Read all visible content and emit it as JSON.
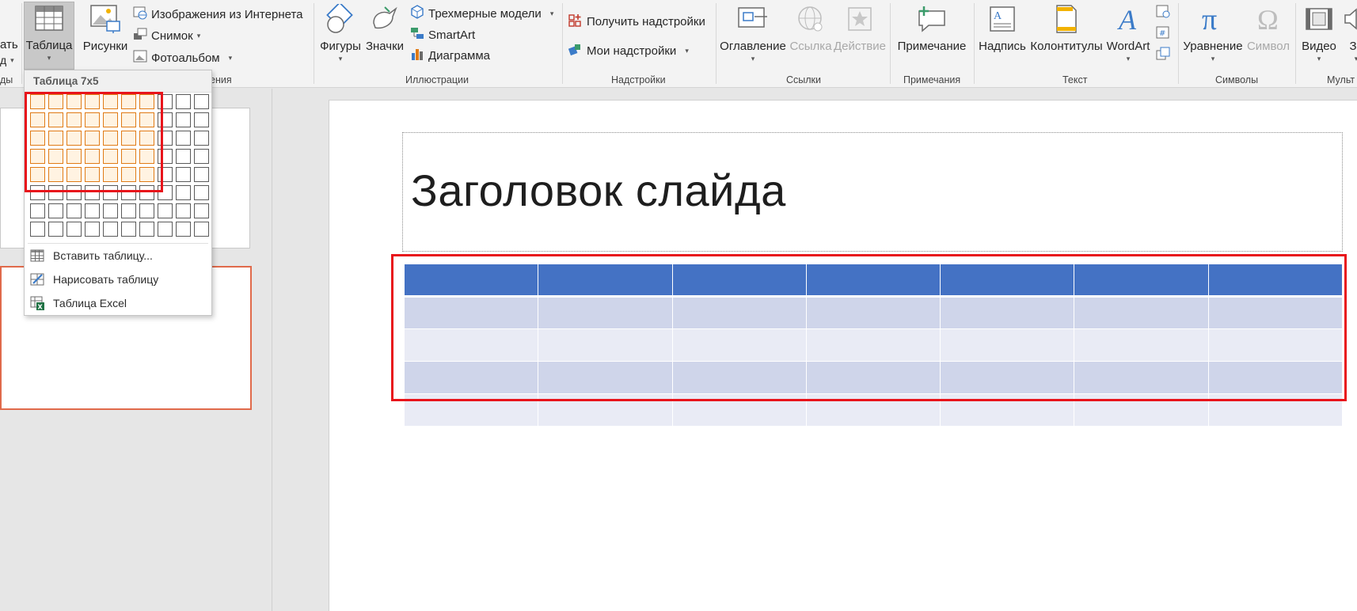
{
  "ribbon": {
    "partial_left_top": "ать",
    "partial_left_mid": "д",
    "partial_left_group": "ды",
    "table_label": "Таблица",
    "images_group_partial": "ения",
    "pictures_label": "Рисунки",
    "online_images_label": "Изображения из Интернета",
    "snapshot_label": "Снимок",
    "photo_album_label": "Фотоальбом",
    "shapes_label": "Фигуры",
    "icons_label": "Значки",
    "models3d_label": "Трехмерные модели",
    "smartart_label": "SmartArt",
    "chart_label": "Диаграмма",
    "illustrations_group": "Иллюстрации",
    "get_addins_label": "Получить надстройки",
    "my_addins_label": "Мои надстройки",
    "addins_group": "Надстройки",
    "toc_label": "Оглавление",
    "link_label": "Ссылка",
    "action_label": "Действие",
    "links_group": "Ссылки",
    "comment_label": "Примечание",
    "comments_group": "Примечания",
    "textbox_label": "Надпись",
    "header_footer_label": "Колонтитулы",
    "wordart_label": "WordArt",
    "text_group": "Текст",
    "equation_label": "Уравнение",
    "symbol_label": "Символ",
    "symbols_group": "Символы",
    "video_label": "Видео",
    "audio_partial": "Зв",
    "media_group_partial": "Мульт"
  },
  "dropdown": {
    "header": "Таблица 7x5",
    "grid": {
      "columns": 10,
      "rows": 8,
      "selected_columns": 7,
      "selected_rows": 5
    },
    "items": [
      {
        "label": "Вставить таблицу...",
        "icon": "insert-table-icon"
      },
      {
        "label": "Нарисовать таблицу",
        "icon": "draw-table-icon"
      },
      {
        "label": "Таблица Excel",
        "icon": "excel-table-icon"
      }
    ]
  },
  "slide": {
    "title": "Заголовок слайда",
    "table": {
      "columns": 7,
      "rows": 5
    }
  },
  "colors": {
    "table_header": "#4472c4",
    "table_band_odd": "#cfd5ea",
    "table_band_even": "#e9ebf5",
    "highlight_frame": "#e8141b",
    "grid_selection": "#e07b16",
    "active_thumbnail_border": "#e06a4b"
  }
}
